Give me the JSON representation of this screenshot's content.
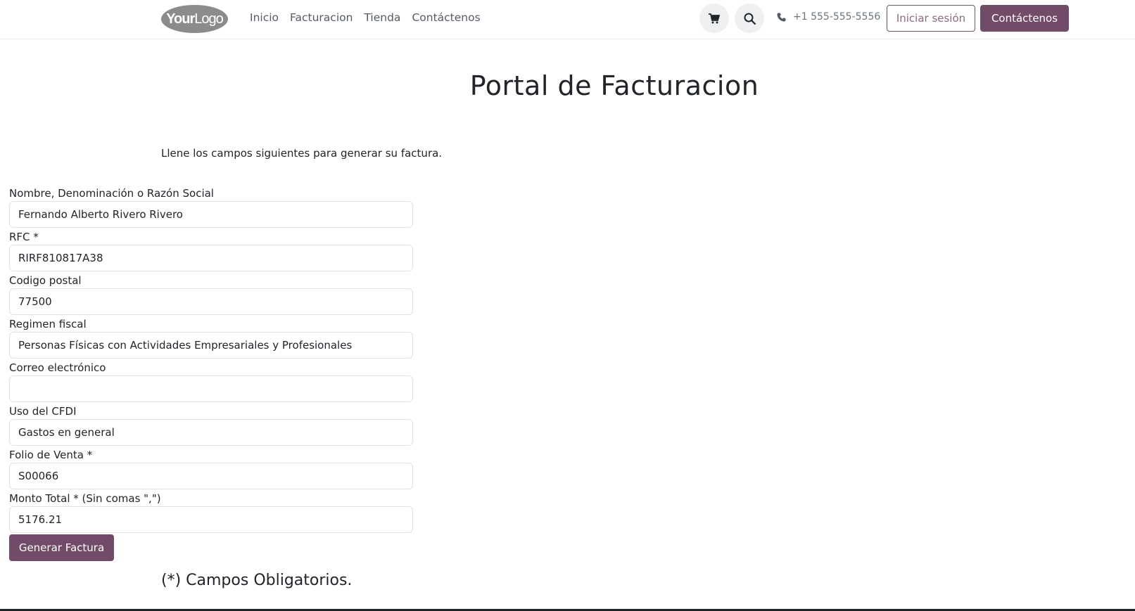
{
  "header": {
    "logo_text_bold": "Your",
    "logo_text": "Logo",
    "nav": [
      "Inicio",
      "Facturacion",
      "Tienda",
      "Contáctenos"
    ],
    "cart_icon": "cart-icon",
    "search_icon": "search-icon",
    "phone_icon": "phone-icon",
    "phone": "+1 555-555-5556",
    "login_label": "Iniciar sesión",
    "contact_label": "Contáctenos",
    "accent_color": "#714b67"
  },
  "main": {
    "title": "Portal de Facturacion",
    "intro": "Llene los campos siguientes para generar su factura.",
    "fields": [
      {
        "label": "Nombre, Denominación o Razón Social",
        "value": "Fernando Alberto Rivero Rivero"
      },
      {
        "label": "RFC *",
        "value": "RIRF810817A38"
      },
      {
        "label": "Codigo postal",
        "value": "77500"
      },
      {
        "label": "Regimen fiscal",
        "value": "Personas Físicas con Actividades Empresariales y Profesionales"
      },
      {
        "label": "Correo electrónico",
        "value": ""
      },
      {
        "label": "Uso del CFDI",
        "value": "Gastos en general"
      },
      {
        "label": "Folio de Venta *",
        "value": "S00066"
      },
      {
        "label": "Monto Total * (Sin comas \",\")",
        "value": "5176.21"
      }
    ],
    "submit_label": "Generar Factura",
    "required_note": "(*) Campos Obligatorios."
  }
}
